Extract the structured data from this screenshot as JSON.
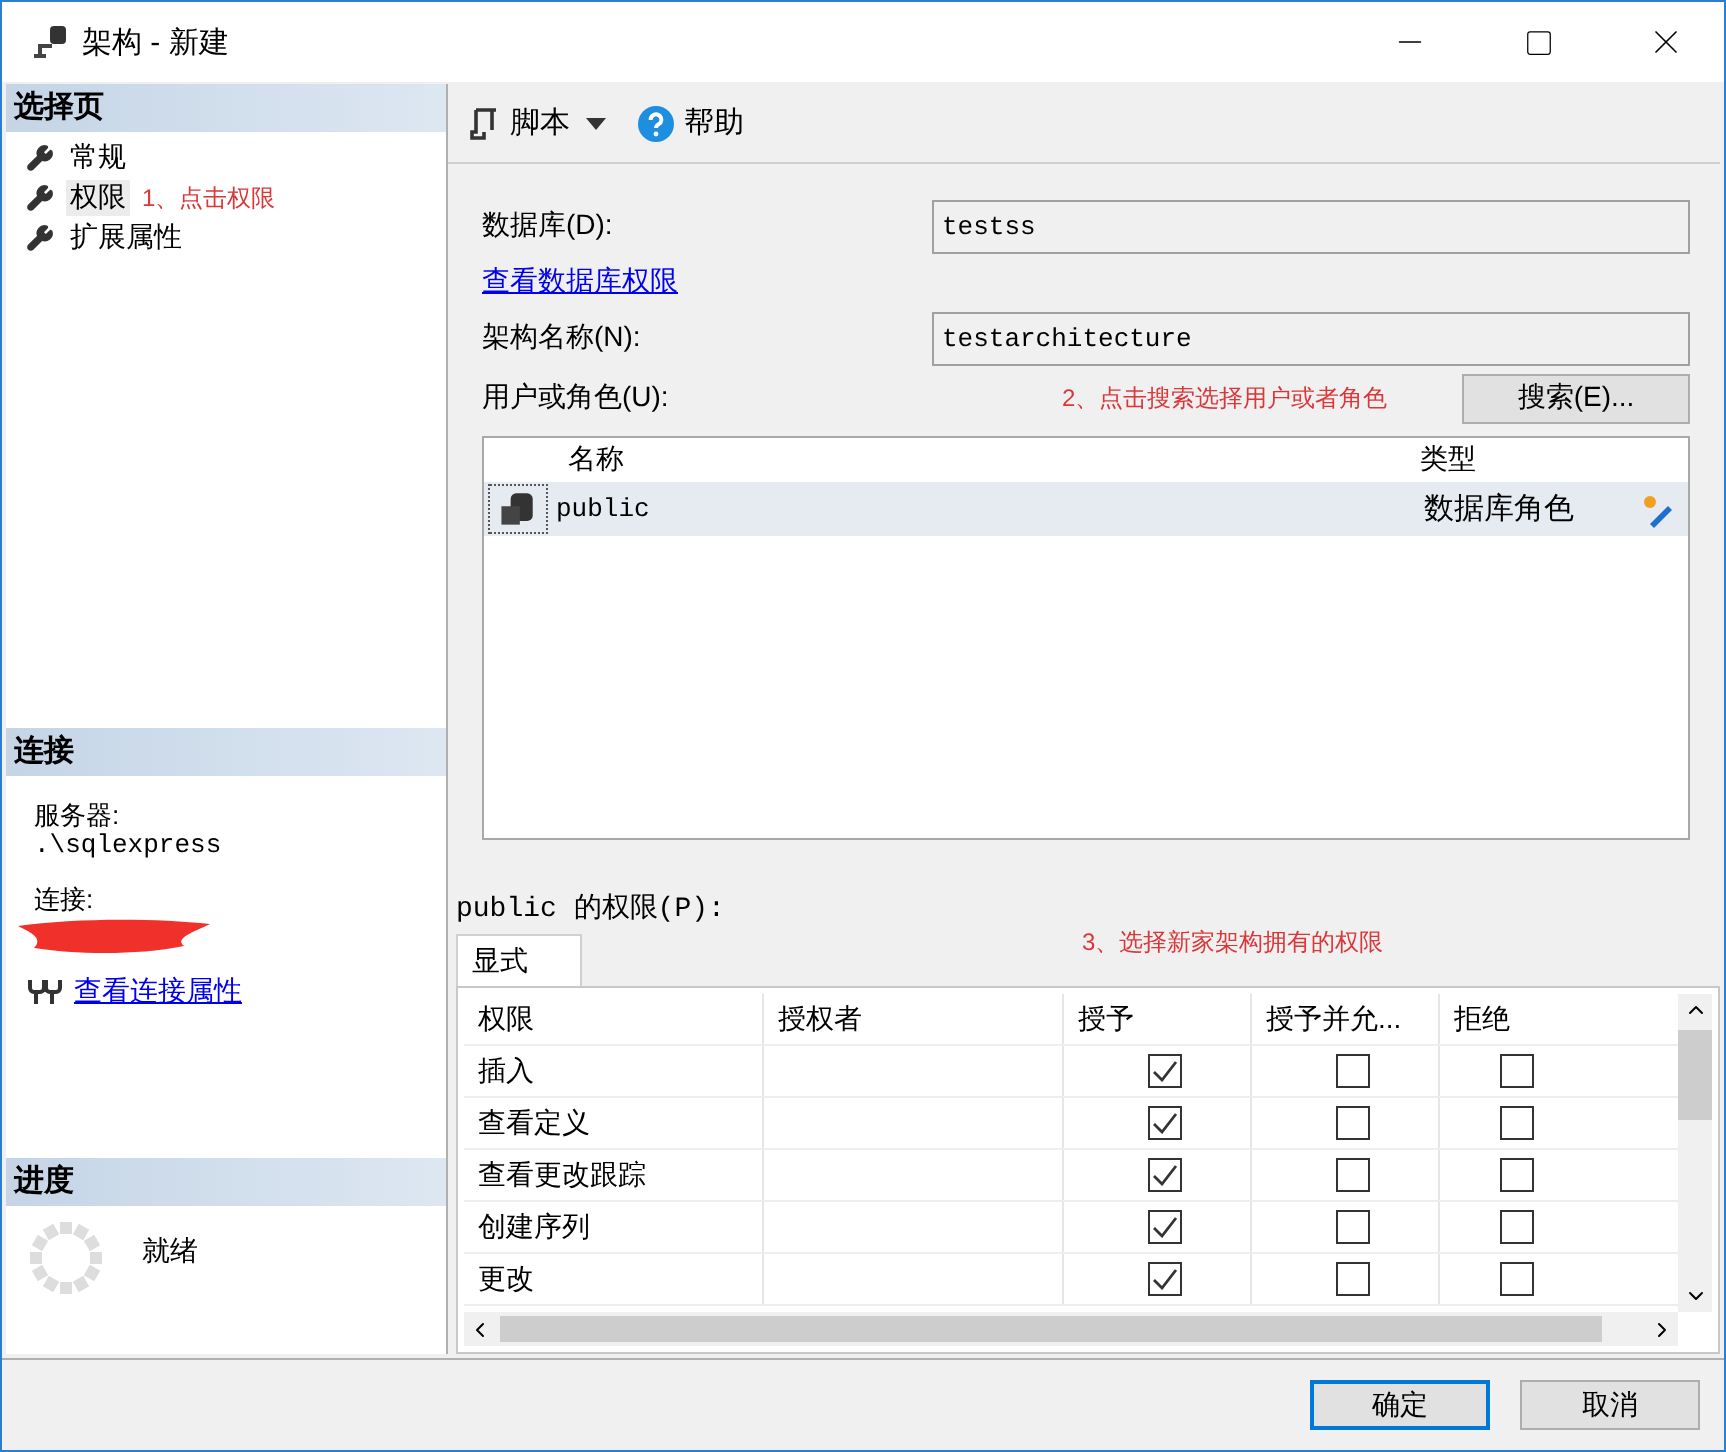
{
  "window": {
    "title": "架构 - 新建"
  },
  "sidebar": {
    "pages_title": "选择页",
    "pages": [
      {
        "label": "常规",
        "selected": false
      },
      {
        "label": "权限",
        "selected": true,
        "note": "1、点击权限"
      },
      {
        "label": "扩展属性",
        "selected": false
      }
    ],
    "connection_title": "连接",
    "server_label": "服务器:",
    "server": ".\\sqlexpress",
    "connection_label": "连接:",
    "connection_link": "查看连接属性",
    "progress_title": "进度",
    "progress_status": "就绪"
  },
  "toolbar": {
    "script": "脚本",
    "help": "帮助"
  },
  "form": {
    "database_label": "数据库(D):",
    "database": "testss",
    "db_permissions_link": "查看数据库权限",
    "schema_label": "架构名称(N):",
    "schema": "testarchitecture",
    "owner_label": "用户或角色(U):",
    "owner_note": "2、点击搜索选择用户或者角色",
    "search_button": "搜索(E)..."
  },
  "users": {
    "columns": [
      "名称",
      "类型"
    ],
    "rows": [
      {
        "name": "public",
        "type": "数据库角色",
        "selected": true
      }
    ]
  },
  "permissions": {
    "label": "public 的权限(P):",
    "note": "3、选择新家架构拥有的权限",
    "tabs": [
      {
        "label": "显式",
        "selected": true
      }
    ],
    "columns": [
      "权限",
      "授权者",
      "授予",
      "授予并允...",
      "拒绝"
    ],
    "rows": [
      {
        "name": "插入",
        "grant": true,
        "with_grant": false,
        "deny": false
      },
      {
        "name": "查看定义",
        "grant": true,
        "with_grant": false,
        "deny": false
      },
      {
        "name": "查看更改跟踪",
        "grant": true,
        "with_grant": false,
        "deny": false
      },
      {
        "name": "创建序列",
        "grant": true,
        "with_grant": false,
        "deny": false
      },
      {
        "name": "更改",
        "grant": true,
        "with_grant": false,
        "deny": false
      }
    ]
  },
  "buttons": [
    {
      "label": "确定",
      "default": true
    },
    {
      "label": "取消",
      "default": false
    }
  ]
}
